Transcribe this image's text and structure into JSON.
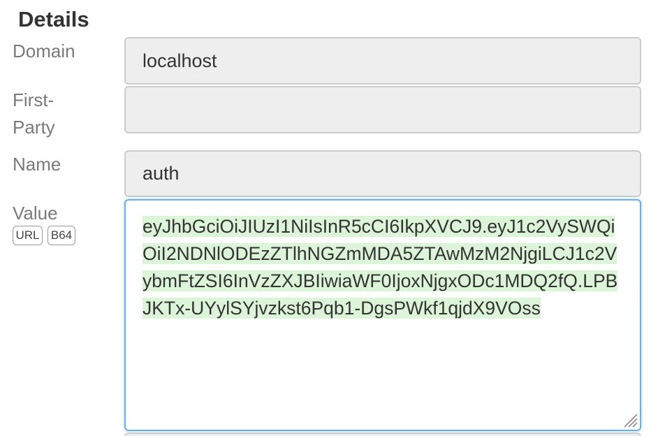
{
  "details": {
    "title": "Details",
    "fields": {
      "domain": {
        "label": "Domain",
        "value": "localhost"
      },
      "first_party": {
        "label_line1": "First-",
        "label_line2": "Party",
        "value": ""
      },
      "name": {
        "label": "Name",
        "value": "auth"
      },
      "value": {
        "label": "Value",
        "content": "eyJhbGciOiJIUzI1NiIsInR5cCI6IkpXVCJ9.eyJ1c2VySWQiOiI2NDNlODEzZTlhNGZmMDA5ZTAwMzM2NjgiLCJ1c2VybmFtZSI6InVzZXJBIiwiaWF0IjoxNjgxODc1MDQ2fQ.LPBJKTx-UYylSYjvzkst6Pqb1-DgsPWkf1qjdX9VOss",
        "badges": {
          "url": "URL",
          "b64": "B64"
        }
      }
    }
  },
  "colors": {
    "focus_border": "#66afe9",
    "highlight": "#dcf5d9",
    "readonly_bg": "#eeeeee"
  },
  "icons": {
    "resize": "resize-grip-icon"
  }
}
